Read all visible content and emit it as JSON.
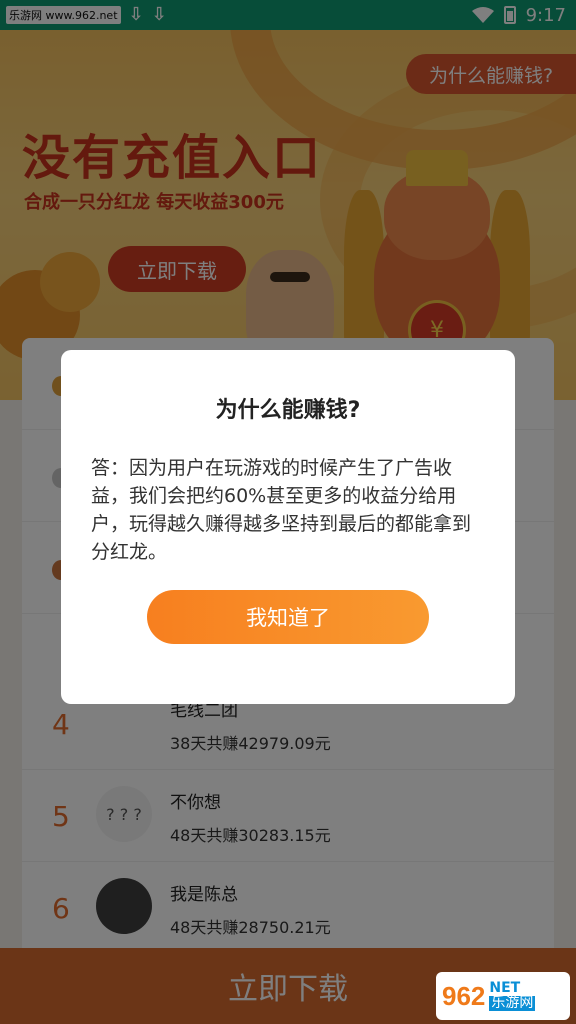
{
  "status_bar": {
    "watermark": "乐游网 www.962.net",
    "time": "9:17",
    "icons": [
      "download-icon",
      "download-icon",
      "wifi-icon",
      "battery-icon"
    ]
  },
  "banner": {
    "why_label": "为什么能赚钱?",
    "title": "没有充值入口",
    "subtitle": "合成一只分红龙 每天收益300元",
    "download_label": "立即下载"
  },
  "leaderboard": {
    "rows": [
      {
        "rank": "4",
        "name": "毛线二团",
        "earn": "38天共赚42979.09元"
      },
      {
        "rank": "5",
        "name": "不你想",
        "earn": "48天共赚30283.15元",
        "avatar_text": "? ? ?"
      },
      {
        "rank": "6",
        "name": "我是陈总",
        "earn": "48天共赚28750.21元"
      }
    ]
  },
  "bottom": {
    "download_label": "立即下载",
    "logo_num": "962",
    "logo_en": "NET",
    "logo_zh": "乐游网"
  },
  "modal": {
    "title": "为什么能赚钱?",
    "body": "答：因为用户在玩游戏的时候产生了广告收益，我们会把约60%甚至更多的收益分给用户，玩得越久赚得越多坚持到最后的都能拿到分红龙。",
    "ok_label": "我知道了"
  },
  "colors": {
    "status_bar": "#0f9a73",
    "accent": "#d9562e",
    "button_gradient_start": "#f77f1f",
    "button_gradient_end": "#f99a30"
  }
}
